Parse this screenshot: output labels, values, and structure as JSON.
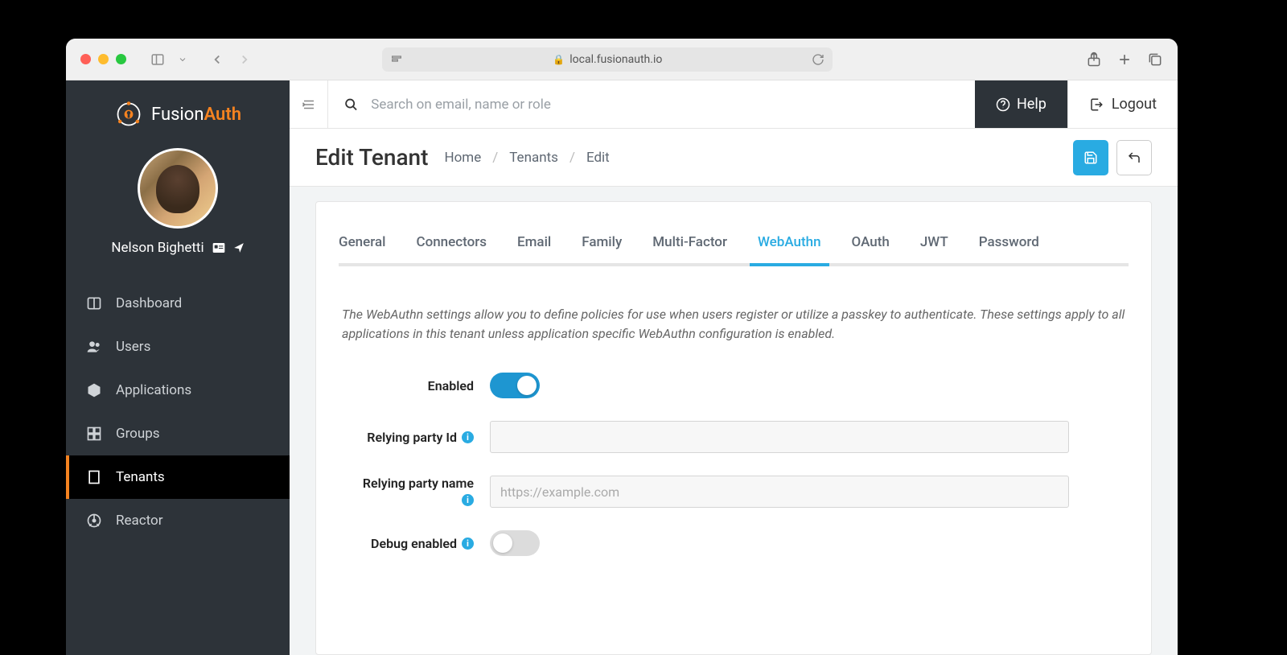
{
  "browser": {
    "url_host": "local.fusionauth.io"
  },
  "app": {
    "logo_text_a": "Fusion",
    "logo_text_b": "Auth",
    "user_name": "Nelson Bighetti"
  },
  "sidebar": {
    "items": [
      {
        "label": "Dashboard"
      },
      {
        "label": "Users"
      },
      {
        "label": "Applications"
      },
      {
        "label": "Groups"
      },
      {
        "label": "Tenants"
      },
      {
        "label": "Reactor"
      }
    ]
  },
  "topbar": {
    "search_placeholder": "Search on email, name or role",
    "help_label": "Help",
    "logout_label": "Logout"
  },
  "page": {
    "title": "Edit Tenant",
    "breadcrumb": [
      "Home",
      "Tenants",
      "Edit"
    ]
  },
  "tabs": [
    {
      "label": "General"
    },
    {
      "label": "Connectors"
    },
    {
      "label": "Email"
    },
    {
      "label": "Family"
    },
    {
      "label": "Multi-Factor"
    },
    {
      "label": "WebAuthn"
    },
    {
      "label": "OAuth"
    },
    {
      "label": "JWT"
    },
    {
      "label": "Password"
    }
  ],
  "webauthn": {
    "description": "The WebAuthn settings allow you to define policies for use when users register or utilize a passkey to authenticate. These settings apply to all applications in this tenant unless application specific WebAuthn configuration is enabled.",
    "enabled_label": "Enabled",
    "enabled_value": true,
    "rp_id_label": "Relying party Id",
    "rp_id_value": "",
    "rp_name_label": "Relying party name",
    "rp_name_value": "",
    "rp_name_placeholder": "https://example.com",
    "debug_label": "Debug enabled",
    "debug_value": false
  },
  "colors": {
    "accent": "#f58320",
    "primary": "#29abe2",
    "sidebar_bg": "#2d3339"
  }
}
